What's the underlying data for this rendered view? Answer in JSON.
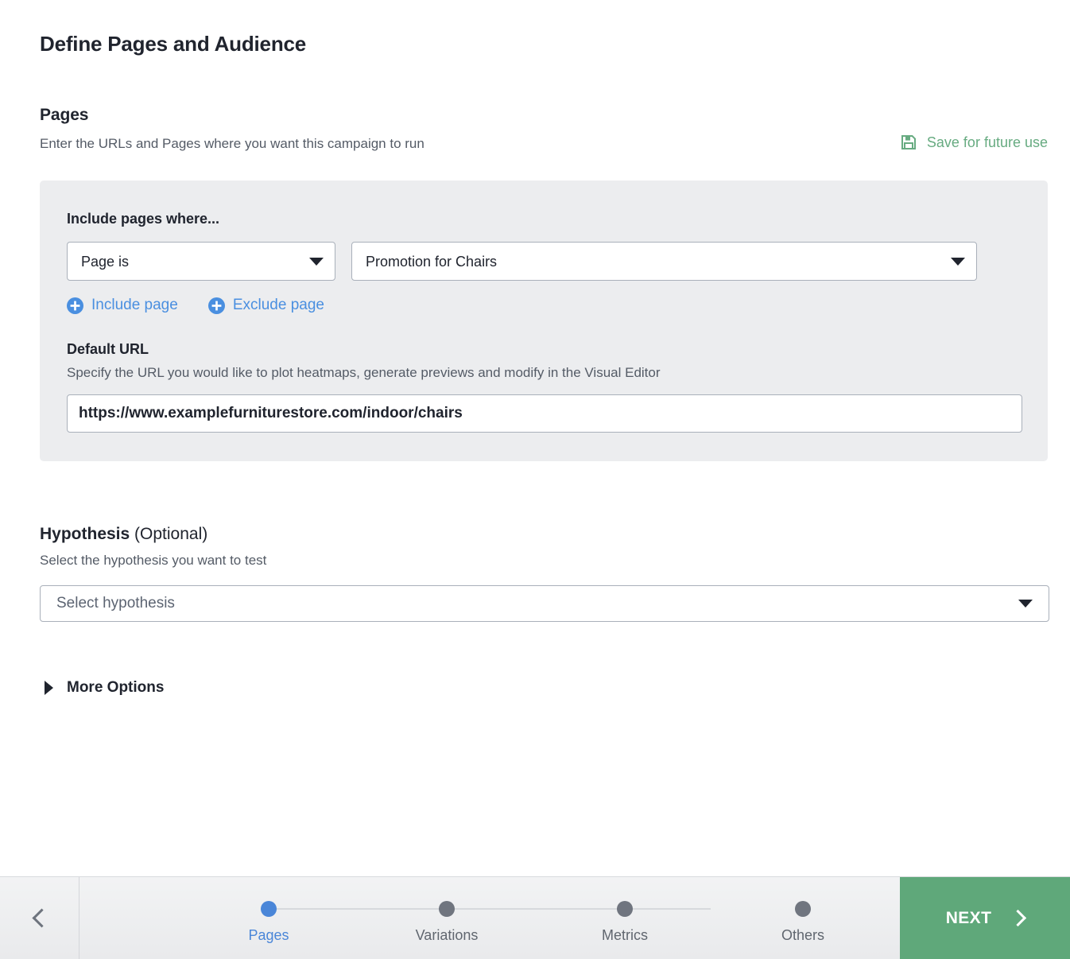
{
  "header": {
    "title": "Define Pages and Audience"
  },
  "pages_section": {
    "title": "Pages",
    "subtitle": "Enter the URLs and Pages where you want this campaign to run",
    "save_link": {
      "label": "Save for future use",
      "icon": "save-floppy-icon",
      "color": "#67ab81"
    },
    "panel": {
      "label": "Include pages where...",
      "condition_select": {
        "value": "Page is",
        "icon": "chevron-down-icon"
      },
      "target_select": {
        "value": "Promotion for Chairs",
        "icon": "chevron-down-icon"
      },
      "include_page_link": {
        "label": "Include page",
        "icon": "plus-circle-icon",
        "color": "#4a8fe0"
      },
      "exclude_page_link": {
        "label": "Exclude page",
        "icon": "plus-circle-icon",
        "color": "#4a8fe0"
      },
      "default_url": {
        "title": "Default URL",
        "description": "Specify the URL you would like to plot heatmaps, generate previews and modify in the Visual Editor",
        "value": "https://www.examplefurniturestore.com/indoor/chairs",
        "placeholder": "Enter URL"
      }
    }
  },
  "hypothesis_section": {
    "title_bold": "Hypothesis",
    "title_rest": " (Optional)",
    "subtitle": "Select the hypothesis you want to test",
    "select": {
      "value": "Select hypothesis",
      "icon": "chevron-down-icon"
    }
  },
  "more_options": {
    "label": "More Options",
    "icon": "triangle-right-icon"
  },
  "bottom_bar": {
    "back_icon": "chevron-left-icon",
    "steps": [
      {
        "label": "Pages",
        "active": true
      },
      {
        "label": "Variations",
        "active": false
      },
      {
        "label": "Metrics",
        "active": false
      },
      {
        "label": "Others",
        "active": false
      }
    ],
    "next_button": {
      "label": "NEXT",
      "icon": "chevron-right-icon",
      "color": "#5fa87a"
    }
  }
}
